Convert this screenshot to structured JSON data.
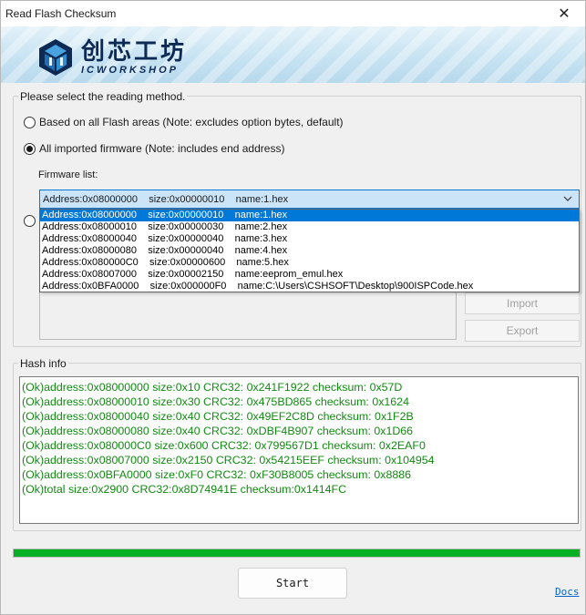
{
  "window": {
    "title": "Read Flash Checksum",
    "close_glyph": "✕"
  },
  "banner": {
    "logo_cn": "创芯工坊",
    "logo_en": "ICWORKSHOP"
  },
  "method": {
    "group_title": "Please select the reading method.",
    "option_all_areas": "Based on all Flash areas (Note: excludes option bytes, default)",
    "option_imported": "All imported firmware (Note: includes end address)",
    "selected": "option_imported",
    "firmware_list_label": "Firmware list:",
    "combo_value": "Address:0x08000000    size:0x00000010    name:1.hex",
    "dropdown_items": [
      "Address:0x08000000    size:0x00000010    name:1.hex",
      "Address:0x08000010    size:0x00000030    name:2.hex",
      "Address:0x08000040    size:0x00000040    name:3.hex",
      "Address:0x08000080    size:0x00000040    name:4.hex",
      "Address:0x080000C0    size:0x00000600    name:5.hex",
      "Address:0x08007000    size:0x00002150    name:eeprom_emul.hex",
      "Address:0x0BFA0000    size:0x000000F0    name:C:\\Users\\CSHSOFT\\Desktop\\900ISPCode.hex"
    ],
    "import_label": "Import",
    "export_label": "Export"
  },
  "hash": {
    "group_title": "Hash info",
    "lines": [
      "(Ok)address:0x08000000 size:0x10  CRC32: 0x241F1922  checksum: 0x57D",
      "(Ok)address:0x08000010 size:0x30  CRC32: 0x475BD865  checksum: 0x1624",
      "(Ok)address:0x08000040 size:0x40  CRC32: 0x49EF2C8D  checksum: 0x1F2B",
      "(Ok)address:0x08000080 size:0x40  CRC32: 0xDBF4B907  checksum: 0x1D66",
      "(Ok)address:0x080000C0 size:0x600  CRC32: 0x799567D1  checksum: 0x2EAF0",
      "(Ok)address:0x08007000 size:0x2150  CRC32: 0x54215EEF  checksum: 0x104954",
      "(Ok)address:0x0BFA0000 size:0xF0  CRC32: 0xF30B8005  checksum: 0x8886",
      "(Ok)total size:0x2900  CRC32:0x8D74941E  checksum:0x1414FC"
    ],
    "text_color": "#118a11"
  },
  "progress": {
    "value_percent": 100,
    "color": "#06b025"
  },
  "footer": {
    "start_label": "Start",
    "docs_label": "Docs"
  }
}
